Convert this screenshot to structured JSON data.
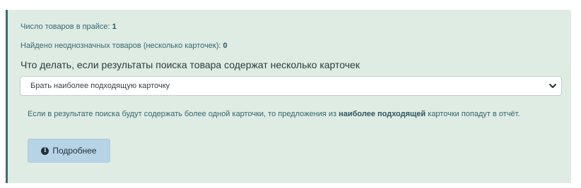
{
  "stats": {
    "price_count_label": "Число товаров в прайсе:",
    "price_count_value": "1",
    "ambiguous_label": "Найдено неоднозначных товаров (несколько карточек):",
    "ambiguous_value": "0"
  },
  "question": "Что делать, если результаты поиска товара содержат несколько карточек",
  "select": {
    "selected_option": "Брать наиболее подходящую карточку"
  },
  "hint": {
    "text_before": "Если в результате поиска будут содержать более одной карточки, то предложения из ",
    "text_bold": "наиболее подходящей",
    "text_after": " карточки попадут в отчёт."
  },
  "more_button": {
    "label": "Подробнее",
    "icon": "info-circle-icon"
  },
  "colors": {
    "panel_bg": "#dfece3",
    "accent_border": "#3d6b73",
    "button_bg": "#b7d3e6"
  }
}
